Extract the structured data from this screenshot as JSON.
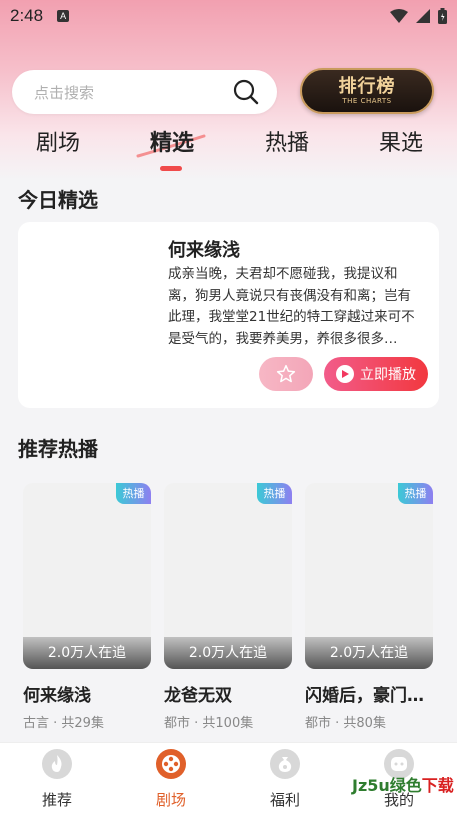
{
  "status_bar": {
    "time": "2:48",
    "indicator": "A"
  },
  "search": {
    "placeholder": "点击搜索"
  },
  "charts_button": {
    "title": "排行榜",
    "subtitle": "THE CHARTS"
  },
  "tabs": [
    {
      "label": "剧场",
      "active": false
    },
    {
      "label": "精选",
      "active": true
    },
    {
      "label": "热播",
      "active": false
    },
    {
      "label": "果选",
      "active": false
    }
  ],
  "today_section": {
    "title": "今日精选",
    "featured": {
      "title": "何来缘浅",
      "description": "成亲当晚，夫君却不愿碰我，我提议和离，狗男人竟说只有丧偶没有和离；岂有此理，我堂堂21世纪的特工穿越过来可不是受气的，我要养美男，养很多很多…",
      "play_label": "立即播放"
    }
  },
  "hot_section": {
    "title": "推荐热播",
    "items": [
      {
        "badge": "热播",
        "viewers": "2.0万人在追",
        "title": "何来缘浅",
        "meta": "古言 · 共29集"
      },
      {
        "badge": "热播",
        "viewers": "2.0万人在追",
        "title": "龙爸无双",
        "meta": "都市 · 共100集"
      },
      {
        "badge": "热播",
        "viewers": "2.0万人在追",
        "title": "闪婚后，豪门…",
        "meta": "都市 · 共80集"
      }
    ]
  },
  "bottom_nav": [
    {
      "label": "推荐",
      "icon": "flame-icon",
      "active": false
    },
    {
      "label": "剧场",
      "icon": "film-reel-icon",
      "active": true
    },
    {
      "label": "福利",
      "icon": "money-bag-icon",
      "active": false
    },
    {
      "label": "我的",
      "icon": "profile-icon",
      "active": false
    }
  ],
  "watermark": {
    "green": "Jz5u绿色",
    "red": "下载"
  },
  "colors": {
    "accent": "#f2383f",
    "active_nav": "#e0602a",
    "badge_start": "#3cc9d6",
    "badge_end": "#8e7ff0"
  }
}
